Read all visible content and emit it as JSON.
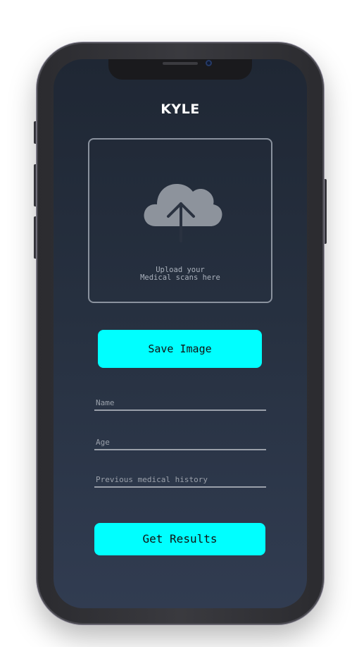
{
  "app": {
    "title": "KYLE"
  },
  "upload": {
    "icon": "cloud-upload-icon",
    "line1": "Upload your",
    "line2": "Medical scans here"
  },
  "buttons": {
    "save_label": "Save Image",
    "results_label": "Get Results"
  },
  "form": {
    "name_placeholder": "Name",
    "age_placeholder": "Age",
    "history_placeholder": "Previous medical history"
  },
  "colors": {
    "accent": "#00ffff",
    "background_top": "#1f2734",
    "background_bottom": "#313c51"
  }
}
